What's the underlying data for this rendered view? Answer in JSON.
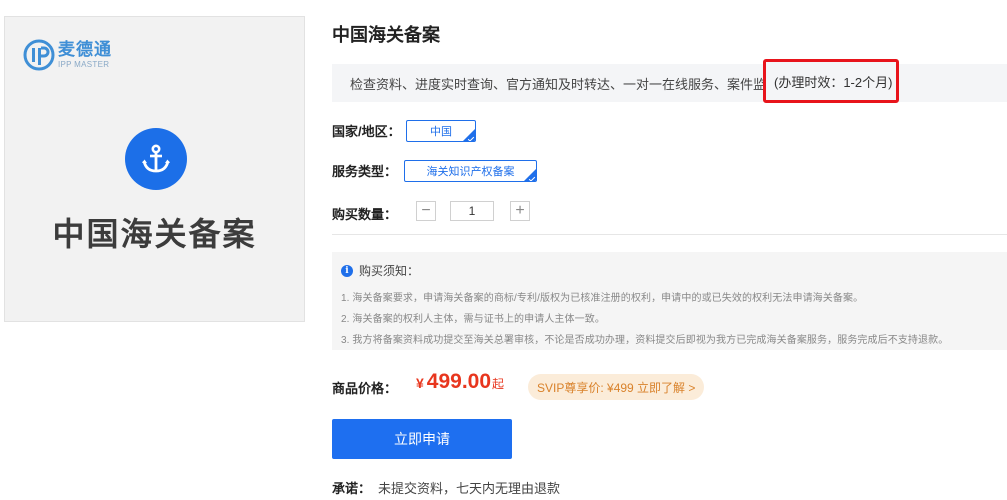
{
  "product_image": {
    "logo_cn": "麦德通",
    "logo_en": "IPP MASTER",
    "title": "中国海关备案"
  },
  "page_title": "中国海关备案",
  "description": {
    "text": "检查资料、进度实时查询、官方通知及时转达、一对一在线服务、案件监控",
    "highlight": "(办理时效：1-2个月)"
  },
  "options": {
    "country_label": "国家/地区：",
    "country_value": "中国",
    "service_label": "服务类型：",
    "service_value": "海关知识产权备案",
    "quantity_label": "购买数量：",
    "quantity_value": "1",
    "minus_symbol": "−",
    "plus_symbol": "+"
  },
  "notice": {
    "heading": "购买须知：",
    "lines": [
      "1. 海关备案要求，申请海关备案的商标/专利/版权为已核准注册的权利，申请中的或已失效的权利无法申请海关备案。",
      "2. 海关备案的权利人主体，需与证书上的申请人主体一致。",
      "3. 我方将备案资料成功提交至海关总署审核，不论是否成功办理，资料提交后即视为我方已完成海关备案服务，服务完成后不支持退款。"
    ]
  },
  "price": {
    "label": "商品价格：",
    "currency": "¥",
    "amount": "499.00",
    "suffix": "起",
    "svip_text": "SVIP尊享价: ¥499 立即了解 >"
  },
  "apply_button": "立即申请",
  "promise": {
    "label": "承诺：",
    "text": "未提交资料，七天内无理由退款"
  },
  "colors": {
    "primary": "#1e6ff0",
    "price": "#e8361e",
    "highlight_border": "#e8141b",
    "svip_bg": "#fbecd9",
    "svip_text": "#d9822b"
  },
  "icons": [
    "ipp-logo-icon",
    "anchor-icon",
    "check-corner-icon",
    "info-icon"
  ]
}
